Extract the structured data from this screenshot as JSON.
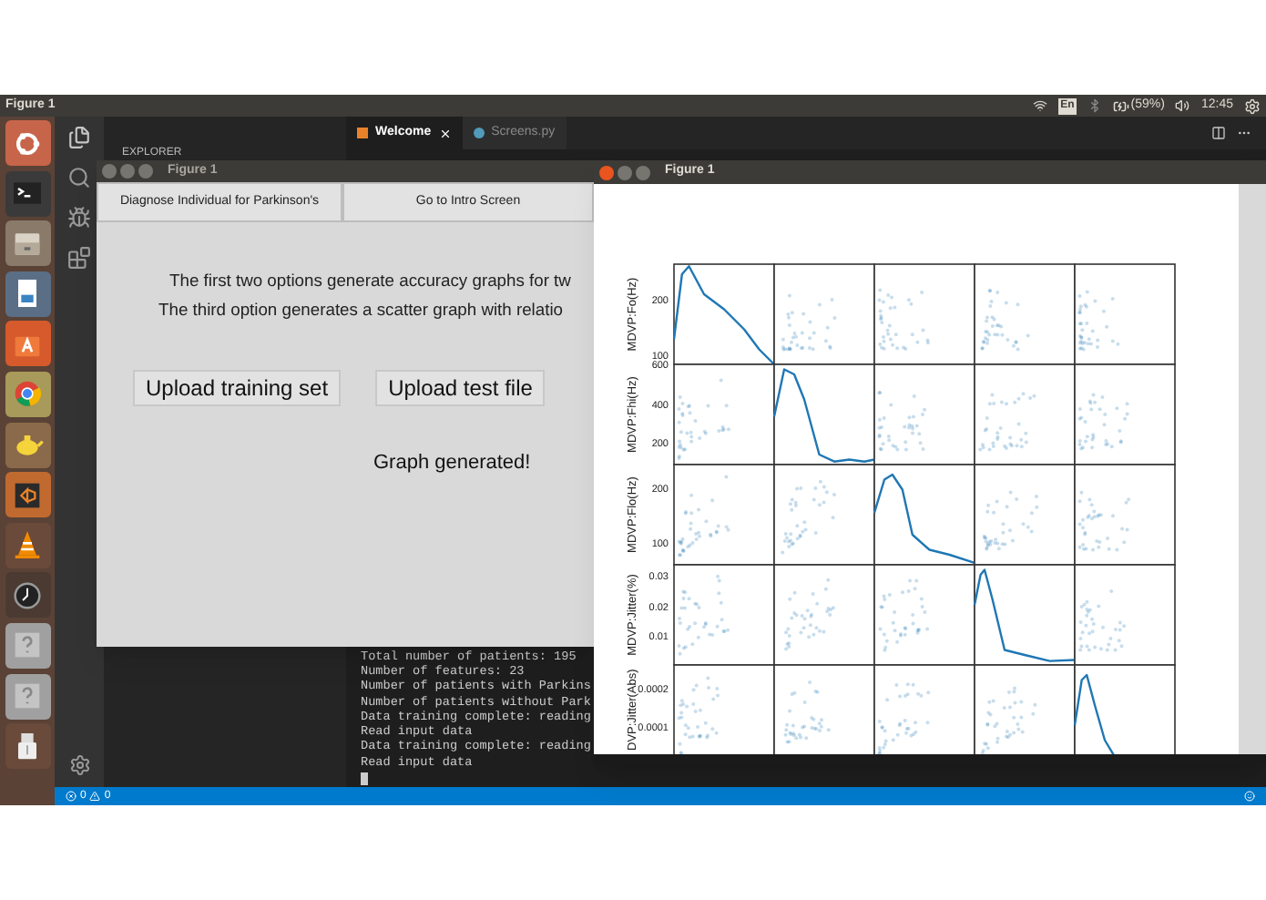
{
  "top_bar": {
    "title": "Figure 1",
    "language": "En",
    "battery": "(59%)",
    "time": "12:45"
  },
  "launcher": [
    {
      "kind": "ubuntu"
    },
    {
      "kind": "terminal"
    },
    {
      "kind": "files"
    },
    {
      "kind": "writer"
    },
    {
      "kind": "software"
    },
    {
      "kind": "browser"
    },
    {
      "kind": "teapot"
    },
    {
      "kind": "editor"
    },
    {
      "kind": "cone"
    },
    {
      "kind": "clock"
    },
    {
      "kind": "unknown"
    },
    {
      "kind": "unknown"
    },
    {
      "kind": "usb"
    }
  ],
  "editor": {
    "sidebar_title": "EXPLORER",
    "tabs": [
      {
        "label": "Welcome",
        "selected": true
      },
      {
        "label": "Screens.py",
        "selected": false
      }
    ],
    "terminal": [
      "Total number of patients: 195",
      "Number of features: 23",
      "Number of patients with Parkins",
      "Number of patients without Park",
      "Data training complete: reading",
      "Read input data",
      "Data training complete: reading",
      "Read input data"
    ],
    "status": {
      "errors": "0",
      "warnings": "0"
    }
  },
  "tk_window": {
    "title": "Figure 1",
    "menu_buttons": [
      "Diagnose Individual for Parkinson's",
      "Go to Intro Screen"
    ],
    "intro_lines": [
      "The first two options generate accuracy graphs for tw",
      "The third option generates a scatter graph with relatio"
    ],
    "buttons": [
      "Upload training set",
      "Upload test file"
    ],
    "message": "Graph generated!"
  },
  "plot_window": {
    "title": "Figure 1",
    "rows": [
      {
        "label": "MDVP:Fo(Hz)",
        "yticks": [
          "200",
          "100"
        ]
      },
      {
        "label": "MDVP:Fhi(Hz)",
        "yticks": [
          "600",
          "400",
          "200"
        ]
      },
      {
        "label": "MDVP:Flo(Hz)",
        "yticks": [
          "200",
          "100"
        ]
      },
      {
        "label": "MDVP:Jitter(%)",
        "yticks": [
          "0.03",
          "0.02",
          "0.01"
        ]
      },
      {
        "label": "DVP:Jitter(Abs)",
        "yticks": [
          "0.0002",
          "0.0001"
        ]
      }
    ]
  }
}
